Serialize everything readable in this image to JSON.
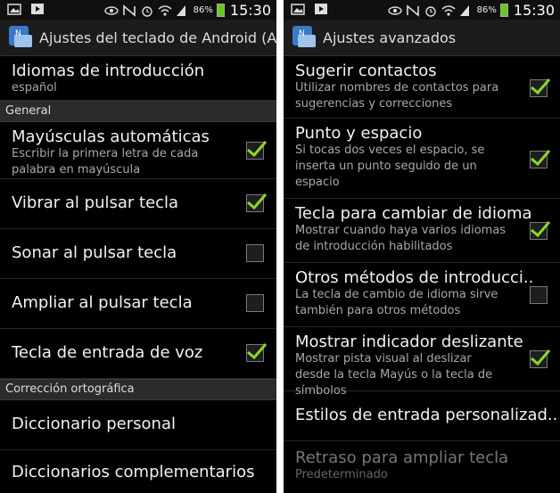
{
  "status": {
    "battery_pct": "86%",
    "time": "15:30"
  },
  "left": {
    "title": "Ajustes del teclado de Android (A..",
    "input_languages": {
      "title": "Idiomas de introducción",
      "value": "español"
    },
    "section_general": "General",
    "items": [
      {
        "title": "Mayúsculas automáticas",
        "summary": "Escribir la primera letra de cada palabra en mayúscula",
        "checked": true
      },
      {
        "title": "Vibrar al pulsar tecla",
        "checked": true
      },
      {
        "title": "Sonar al pulsar tecla",
        "checked": false
      },
      {
        "title": "Ampliar al pulsar tecla",
        "checked": false
      },
      {
        "title": "Tecla de entrada de voz",
        "checked": true
      }
    ],
    "section_spelling": "Corrección ortográfica",
    "personal_dictionary": "Diccionario personal",
    "addon_dictionaries": "Diccionarios complementarios"
  },
  "right": {
    "title": "Ajustes avanzados",
    "items": [
      {
        "title": "Sugerir contactos",
        "summary": "Utilizar nombres de contactos para sugerencias y correcciones",
        "checked": true
      },
      {
        "title": "Punto y espacio",
        "summary": "Si tocas dos veces el espacio, se inserta un punto seguido de un espacio",
        "checked": true
      },
      {
        "title": "Tecla para cambiar de idioma",
        "summary": "Mostrar cuando haya varios idiomas de introducción habilitados",
        "checked": true
      },
      {
        "title": "Otros métodos de introducci..",
        "summary": "La tecla de cambio de idioma sirve también para otros métodos",
        "checked": false
      },
      {
        "title": "Mostrar indicador deslizante",
        "summary": "Mostrar pista visual al deslizar desde la tecla Mayús o la tecla de símbolos",
        "checked": true
      }
    ],
    "custom_styles": "Estilos de entrada personalizad..",
    "key_delay": {
      "title": "Retraso para ampliar tecla",
      "value": "Predeterminado"
    }
  },
  "colors": {
    "check": "#8fd62a",
    "section_bg": "#2b2b2b"
  }
}
